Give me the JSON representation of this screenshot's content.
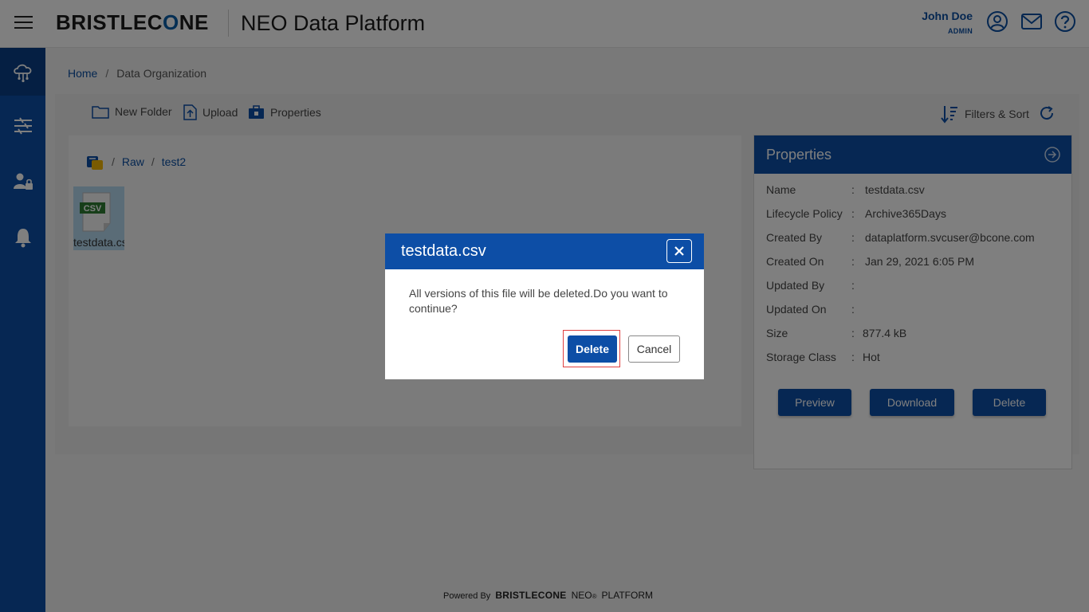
{
  "header": {
    "logo_pre": "BRISTLEC",
    "logo_o": "O",
    "logo_post": "NE",
    "app_title": "NEO Data Platform",
    "user_name": "John Doe",
    "user_role": "ADMIN"
  },
  "breadcrumb": {
    "home": "Home",
    "current": "Data Organization"
  },
  "toolbar": {
    "new_folder": "New Folder",
    "upload": "Upload",
    "properties": "Properties",
    "filters_sort": "Filters & Sort"
  },
  "path": {
    "segments": [
      "Raw",
      "test2"
    ]
  },
  "file": {
    "badge": "CSV",
    "name": "testdata.csv"
  },
  "properties": {
    "title": "Properties",
    "rows": [
      {
        "label": "Name",
        "value": "testdata.csv"
      },
      {
        "label": "Lifecycle Policy",
        "value": "Archive365Days"
      },
      {
        "label": "Created By",
        "value": "dataplatform.svcuser@bcone.com"
      },
      {
        "label": "Created On",
        "value": "Jan 29, 2021 6:05 PM"
      },
      {
        "label": "Updated By",
        "value": ""
      },
      {
        "label": "Updated On",
        "value": ""
      },
      {
        "label": "Size",
        "value": "877.4 kB"
      },
      {
        "label": "Storage Class",
        "value": "Hot"
      }
    ],
    "preview_label": "Preview",
    "download_label": "Download",
    "delete_label": "Delete"
  },
  "modal": {
    "title": "testdata.csv",
    "message": "All versions of this file will be deleted.Do you want to continue?",
    "delete_label": "Delete",
    "cancel_label": "Cancel"
  },
  "footer": {
    "powered_by": "Powered By",
    "logo": "BRISTLECONE",
    "neo": "NEO",
    "registered": "®",
    "platform": "PLATFORM"
  },
  "colors": {
    "primary": "#0d4ea6",
    "sidebar_active": "#0a3f86",
    "highlight": "#e04040"
  }
}
